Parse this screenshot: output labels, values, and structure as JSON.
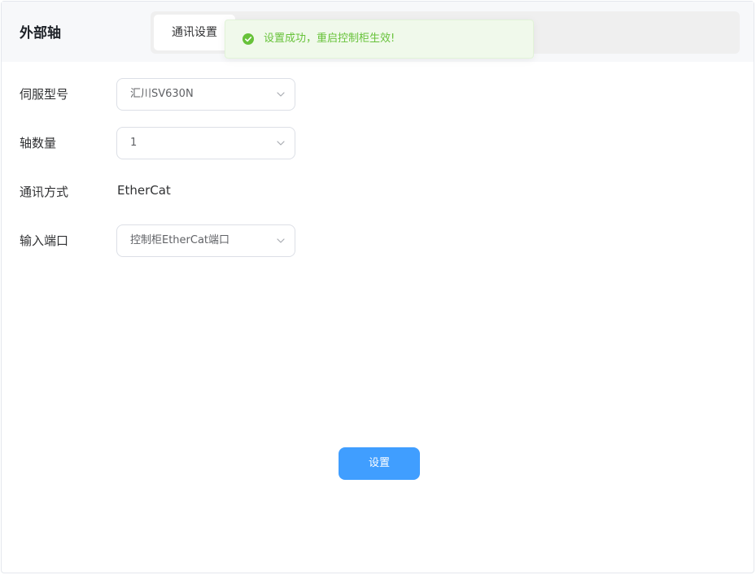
{
  "header": {
    "title": "外部轴",
    "tabs": [
      {
        "label": "通讯设置",
        "active": true
      }
    ]
  },
  "toast": {
    "type": "success",
    "icon": "check-circle-icon",
    "message": "设置成功，重启控制柜生效!",
    "color": "#67c23a"
  },
  "form": {
    "servo_model": {
      "label": "伺服型号",
      "value": "汇川SV630N"
    },
    "axis_count": {
      "label": "轴数量",
      "value": "1"
    },
    "comm_mode": {
      "label": "通讯方式",
      "value": "EtherCat"
    },
    "input_port": {
      "label": "输入端口",
      "value": "控制柜EtherCat端口"
    }
  },
  "actions": {
    "submit_label": "设置",
    "accent_color": "#409eff"
  }
}
